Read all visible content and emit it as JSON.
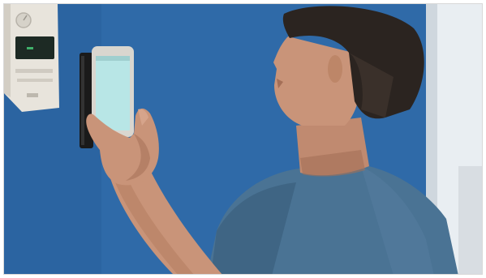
{
  "photo": {
    "subject": "",
    "colors": {
      "wall": "#2f6aa8",
      "wall_shadow": "#23558c",
      "door_frame": "#e9eef2",
      "thermostat_body": "#e8e4dc",
      "thermostat_screen": "#1d2a24",
      "phone_body": "#d9d6cf",
      "phone_screen": "#b8e6e6",
      "skin": "#c99479",
      "skin_shadow": "#a46f57",
      "hair": "#2b2420",
      "shirt": "#4a7394",
      "shirt_shadow": "#3a5f7d",
      "reader_device": "#1a1a1a"
    }
  }
}
